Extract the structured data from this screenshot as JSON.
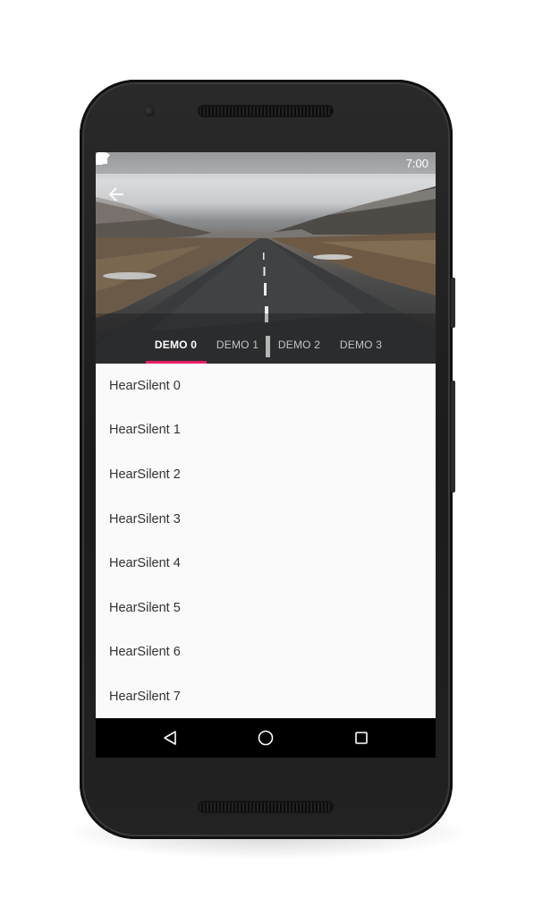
{
  "status_bar": {
    "time": "7:00",
    "icons": [
      "wifi-icon",
      "signal-icon",
      "battery-icon"
    ]
  },
  "toolbar": {
    "back_icon": "arrow-back-icon"
  },
  "tabs": [
    {
      "label": "DEMO 0",
      "active": true
    },
    {
      "label": "DEMO 1",
      "active": false
    },
    {
      "label": "DEMO 2",
      "active": false
    },
    {
      "label": "DEMO 3",
      "active": false
    }
  ],
  "list": [
    "HearSilent 0",
    "HearSilent 1",
    "HearSilent 2",
    "HearSilent 3",
    "HearSilent 4",
    "HearSilent 5",
    "HearSilent 6",
    "HearSilent 7"
  ],
  "nav_bar": {
    "icons": [
      "back-triangle-icon",
      "home-circle-icon",
      "recents-square-icon"
    ]
  },
  "colors": {
    "tab_indicator": "#e91e63",
    "nav_bar": "#000000",
    "list_background": "#fafafa"
  }
}
